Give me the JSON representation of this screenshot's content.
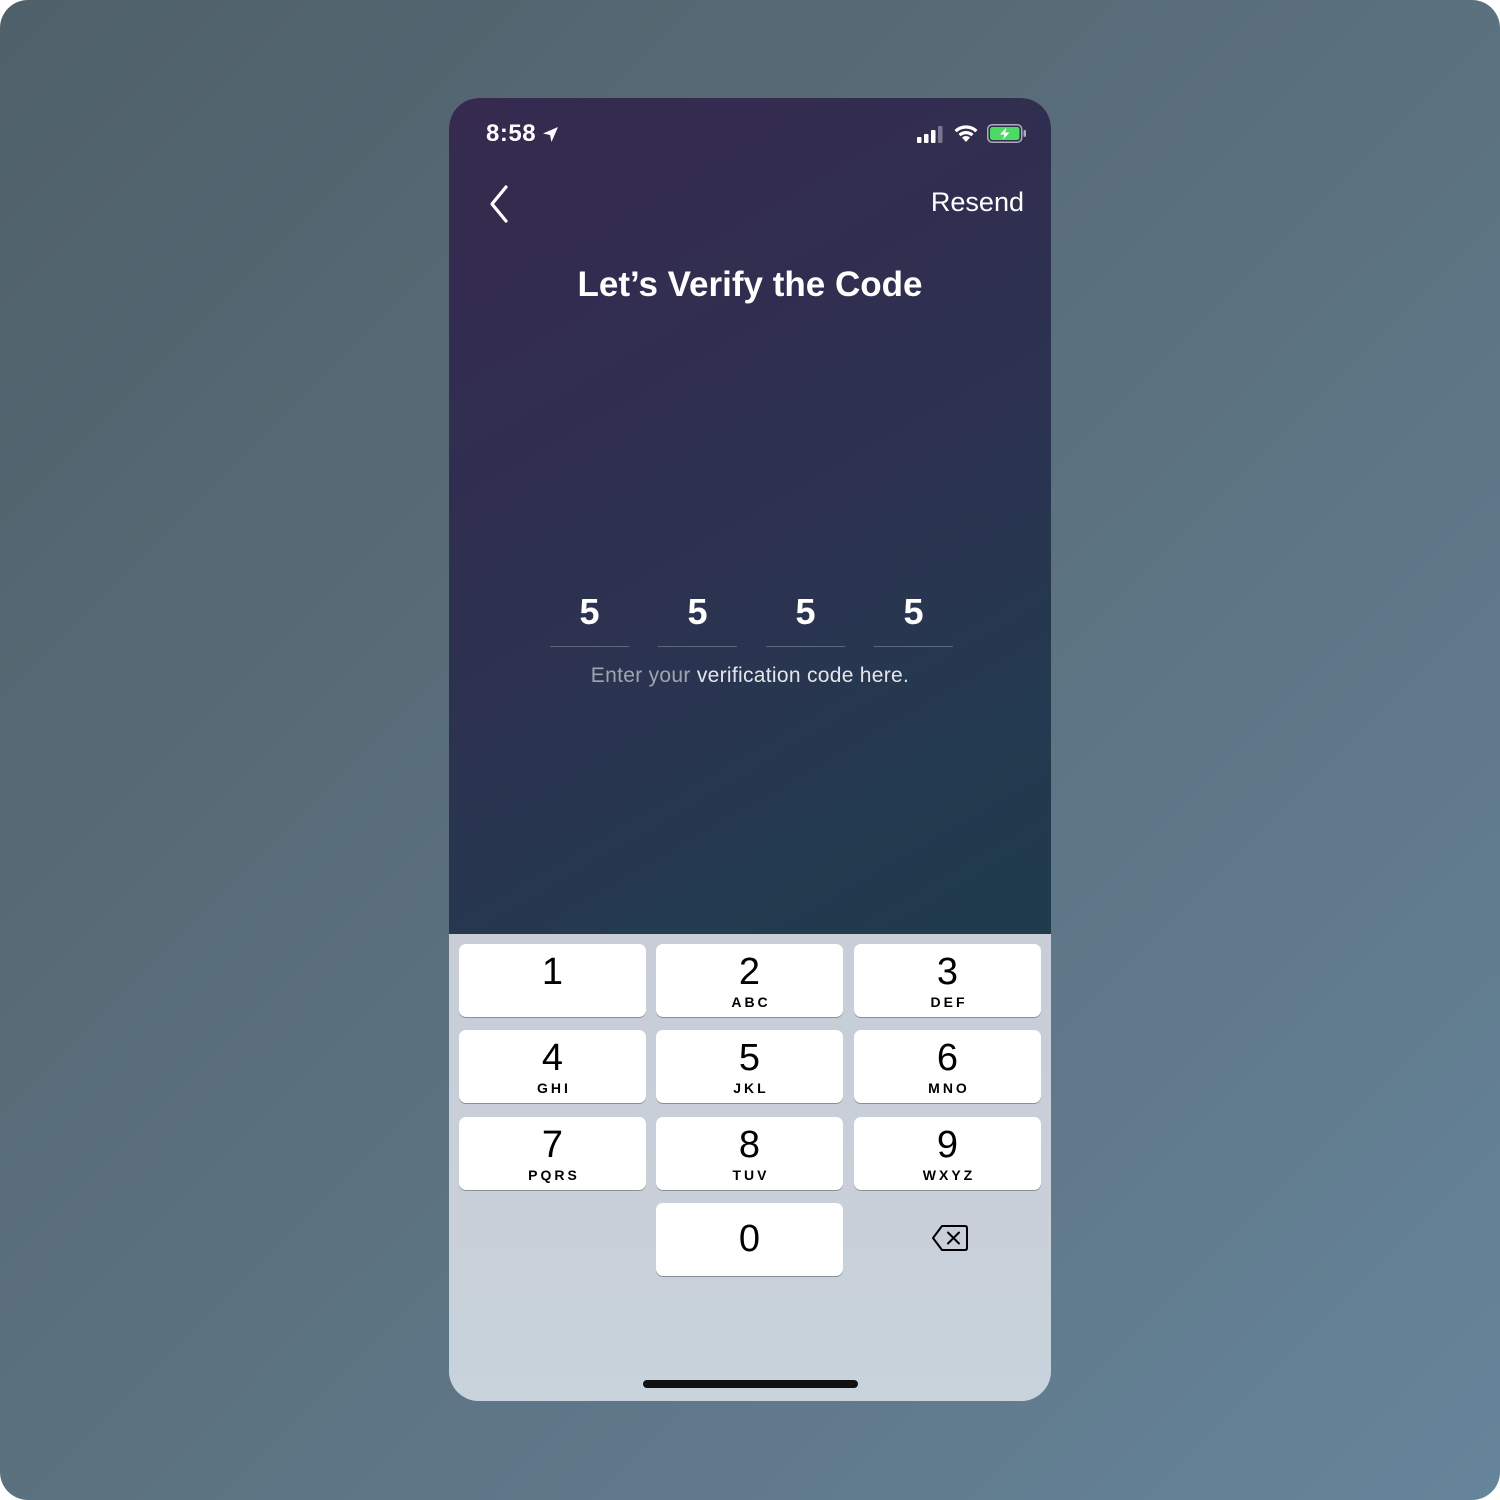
{
  "status_bar": {
    "time": "8:58",
    "icons": [
      "location-arrow-icon",
      "signal-icon",
      "wifi-icon",
      "battery-charging-icon"
    ]
  },
  "nav": {
    "back_icon": "chevron-left-icon",
    "resend_label": "Resend"
  },
  "title": "Let’s Verify the Code",
  "code": {
    "digits": [
      "5",
      "5",
      "5",
      "5"
    ]
  },
  "hint": {
    "dim_part": "Enter your",
    "bright_part": "verification code here."
  },
  "keypad": {
    "keys": [
      {
        "num": "1",
        "letters": ""
      },
      {
        "num": "2",
        "letters": "ABC"
      },
      {
        "num": "3",
        "letters": "DEF"
      },
      {
        "num": "4",
        "letters": "GHI"
      },
      {
        "num": "5",
        "letters": "JKL"
      },
      {
        "num": "6",
        "letters": "MNO"
      },
      {
        "num": "7",
        "letters": "PQRS"
      },
      {
        "num": "8",
        "letters": "TUV"
      },
      {
        "num": "9",
        "letters": "WXYZ"
      },
      {
        "num": "0",
        "letters": ""
      }
    ],
    "delete_icon": "backspace-icon"
  },
  "colors": {
    "background": "#5a6f7c",
    "screen_gradient_start": "#362a4f",
    "screen_gradient_end": "#1f3b4c",
    "keypad_background": "#c9ced7",
    "battery_green": "#4cd964"
  }
}
